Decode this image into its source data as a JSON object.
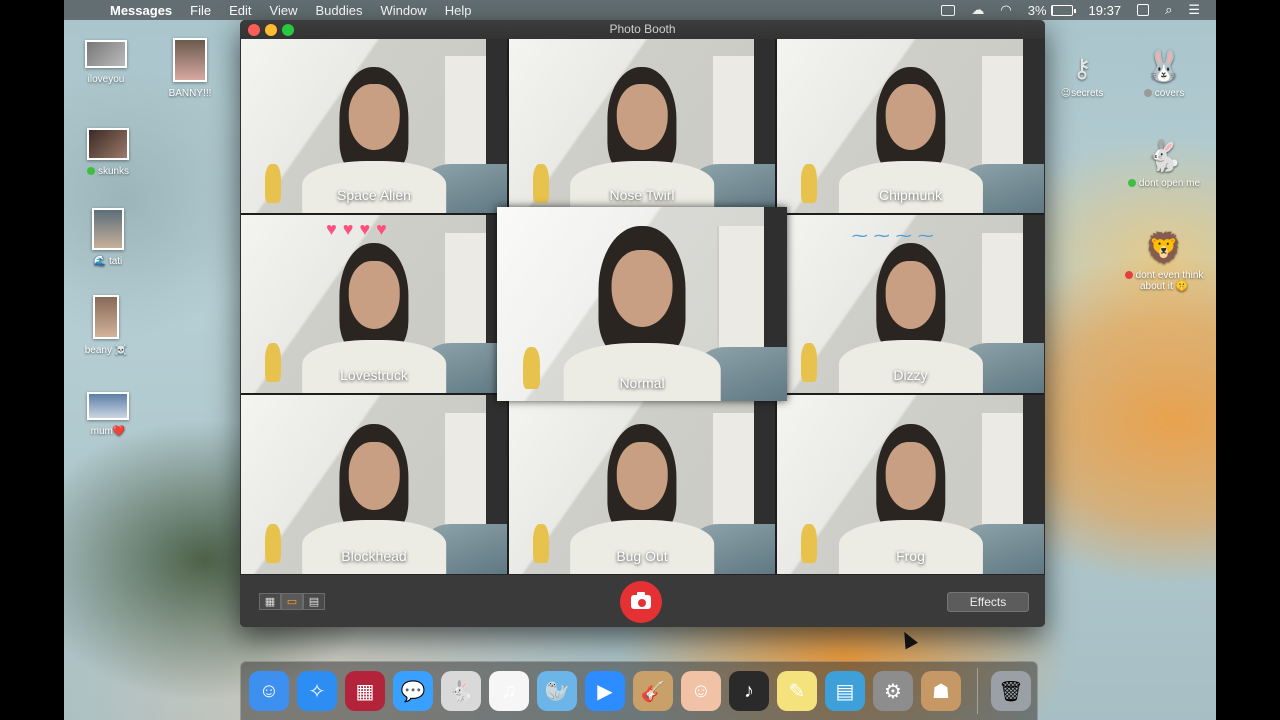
{
  "menubar": {
    "app": "Messages",
    "items": [
      "File",
      "Edit",
      "View",
      "Buddies",
      "Window",
      "Help"
    ],
    "battery": "3%",
    "time": "19:37",
    "battery_level_fraction": 0.03
  },
  "window": {
    "title": "Photo Booth",
    "effects_button": "Effects",
    "tiles": [
      {
        "label": "Space Alien"
      },
      {
        "label": "Nose Twirl"
      },
      {
        "label": "Chipmunk"
      },
      {
        "label": "Lovestruck"
      },
      {
        "label": "Normal"
      },
      {
        "label": "Dizzy"
      },
      {
        "label": "Blockhead"
      },
      {
        "label": "Bug Out"
      },
      {
        "label": "Frog"
      }
    ],
    "view_modes": [
      "grid-view",
      "single-view",
      "strip-view"
    ],
    "active_view": "single-view"
  },
  "desktop_icons": [
    {
      "label": "iloveyou"
    },
    {
      "label": "BANNY!!!"
    },
    {
      "label": "skunks",
      "dot": "#3fbf3f"
    },
    {
      "label": "tati",
      "prefix": "🌊"
    },
    {
      "label": "beany ☠️"
    },
    {
      "label": "mum❤️"
    },
    {
      "label": "secrets",
      "prefix": "😉"
    },
    {
      "label": "covers",
      "dot": "#9a9a9a"
    },
    {
      "label": "dont open me",
      "dot": "#3fbf3f"
    },
    {
      "label": "dont even think about it 🤫",
      "dot": "#e34040"
    }
  ],
  "dock": {
    "apps": [
      {
        "name": "finder-icon",
        "glyph": "☺",
        "bg": "#3d8ff0"
      },
      {
        "name": "safari-icon",
        "glyph": "✧",
        "bg": "#2d8df3"
      },
      {
        "name": "photo-booth-icon",
        "glyph": "▦",
        "bg": "#b3233a"
      },
      {
        "name": "messages-icon",
        "glyph": "💬",
        "bg": "#3aa0ff"
      },
      {
        "name": "app-icon",
        "glyph": "🐇",
        "bg": "#d9d9d9"
      },
      {
        "name": "itunes-icon",
        "glyph": "♫",
        "bg": "#f6f6f6"
      },
      {
        "name": "app2-icon",
        "glyph": "🦭",
        "bg": "#6bb5e8"
      },
      {
        "name": "zoom-icon",
        "glyph": "▶",
        "bg": "#2d8cff"
      },
      {
        "name": "garageband-icon",
        "glyph": "🎸",
        "bg": "#caa06a"
      },
      {
        "name": "app3-icon",
        "glyph": "☺",
        "bg": "#f1c2a6"
      },
      {
        "name": "app4-icon",
        "glyph": "♪",
        "bg": "#2a2a2a"
      },
      {
        "name": "stickies-icon",
        "glyph": "✎",
        "bg": "#f4e27c"
      },
      {
        "name": "preview-icon",
        "glyph": "▤",
        "bg": "#3ea0d8"
      },
      {
        "name": "system-preferences-icon",
        "glyph": "⚙",
        "bg": "#8d8d8d"
      },
      {
        "name": "contacts-icon",
        "glyph": "☗",
        "bg": "#c59866"
      }
    ],
    "trash": {
      "name": "trash-icon",
      "glyph": "🗑",
      "bg": "#9aa0a6"
    }
  }
}
